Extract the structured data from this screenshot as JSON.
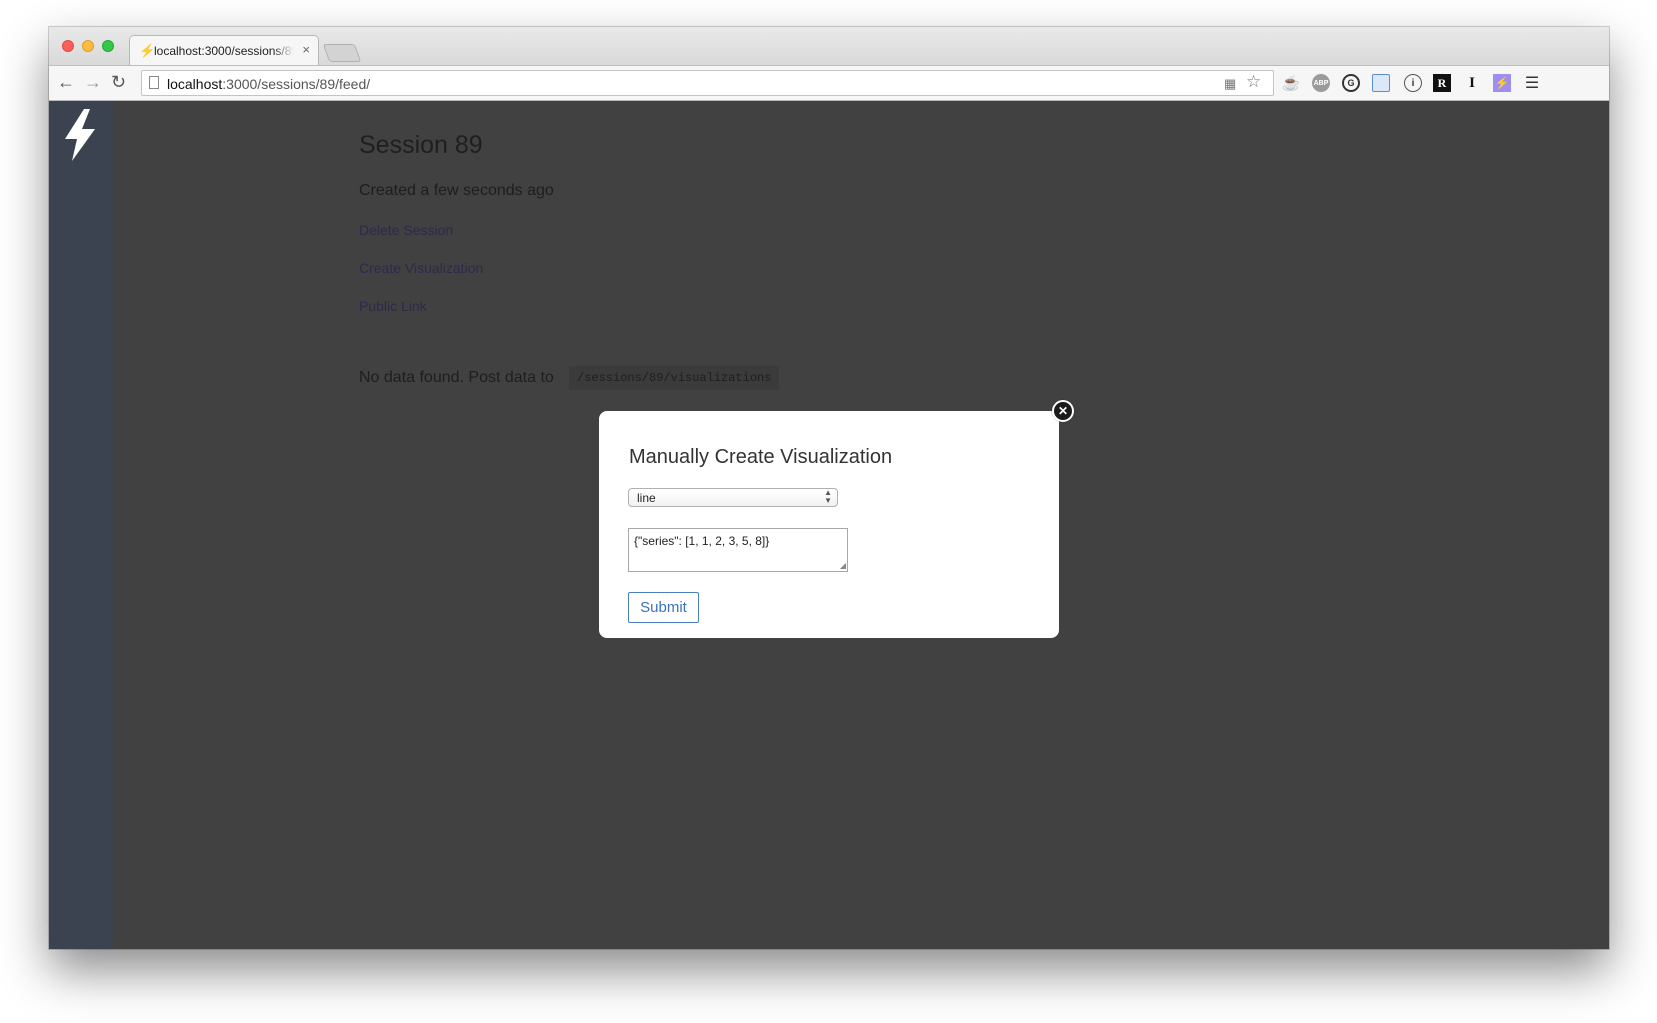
{
  "browser": {
    "tab": {
      "title": "localhost:3000/sessions/89/feed/",
      "favicon": "lightning-bolt-icon",
      "close_glyph": "×"
    },
    "address": {
      "host": "localhost",
      "rest": ":3000/sessions/89/feed/"
    }
  },
  "sidebar": {
    "logo_icon": "lightning-bolt-icon"
  },
  "page": {
    "title": "Session 89",
    "created": "Created a few seconds ago",
    "links": {
      "delete": "Delete Session",
      "create": "Create Visualization",
      "public": "Public Link"
    },
    "no_data_text": "No data found. Post data to",
    "post_path": "/sessions/89/visualizations"
  },
  "modal": {
    "title": "Manually Create Visualization",
    "select_value": "line",
    "textarea_value": "{\"series\": [1, 1, 2, 3, 5, 8]}",
    "submit_label": "Submit"
  },
  "colors": {
    "page_background": "#414141",
    "sidebar": "#3c4350",
    "link": "#2c2a4a",
    "accent": "#3a72bd"
  }
}
